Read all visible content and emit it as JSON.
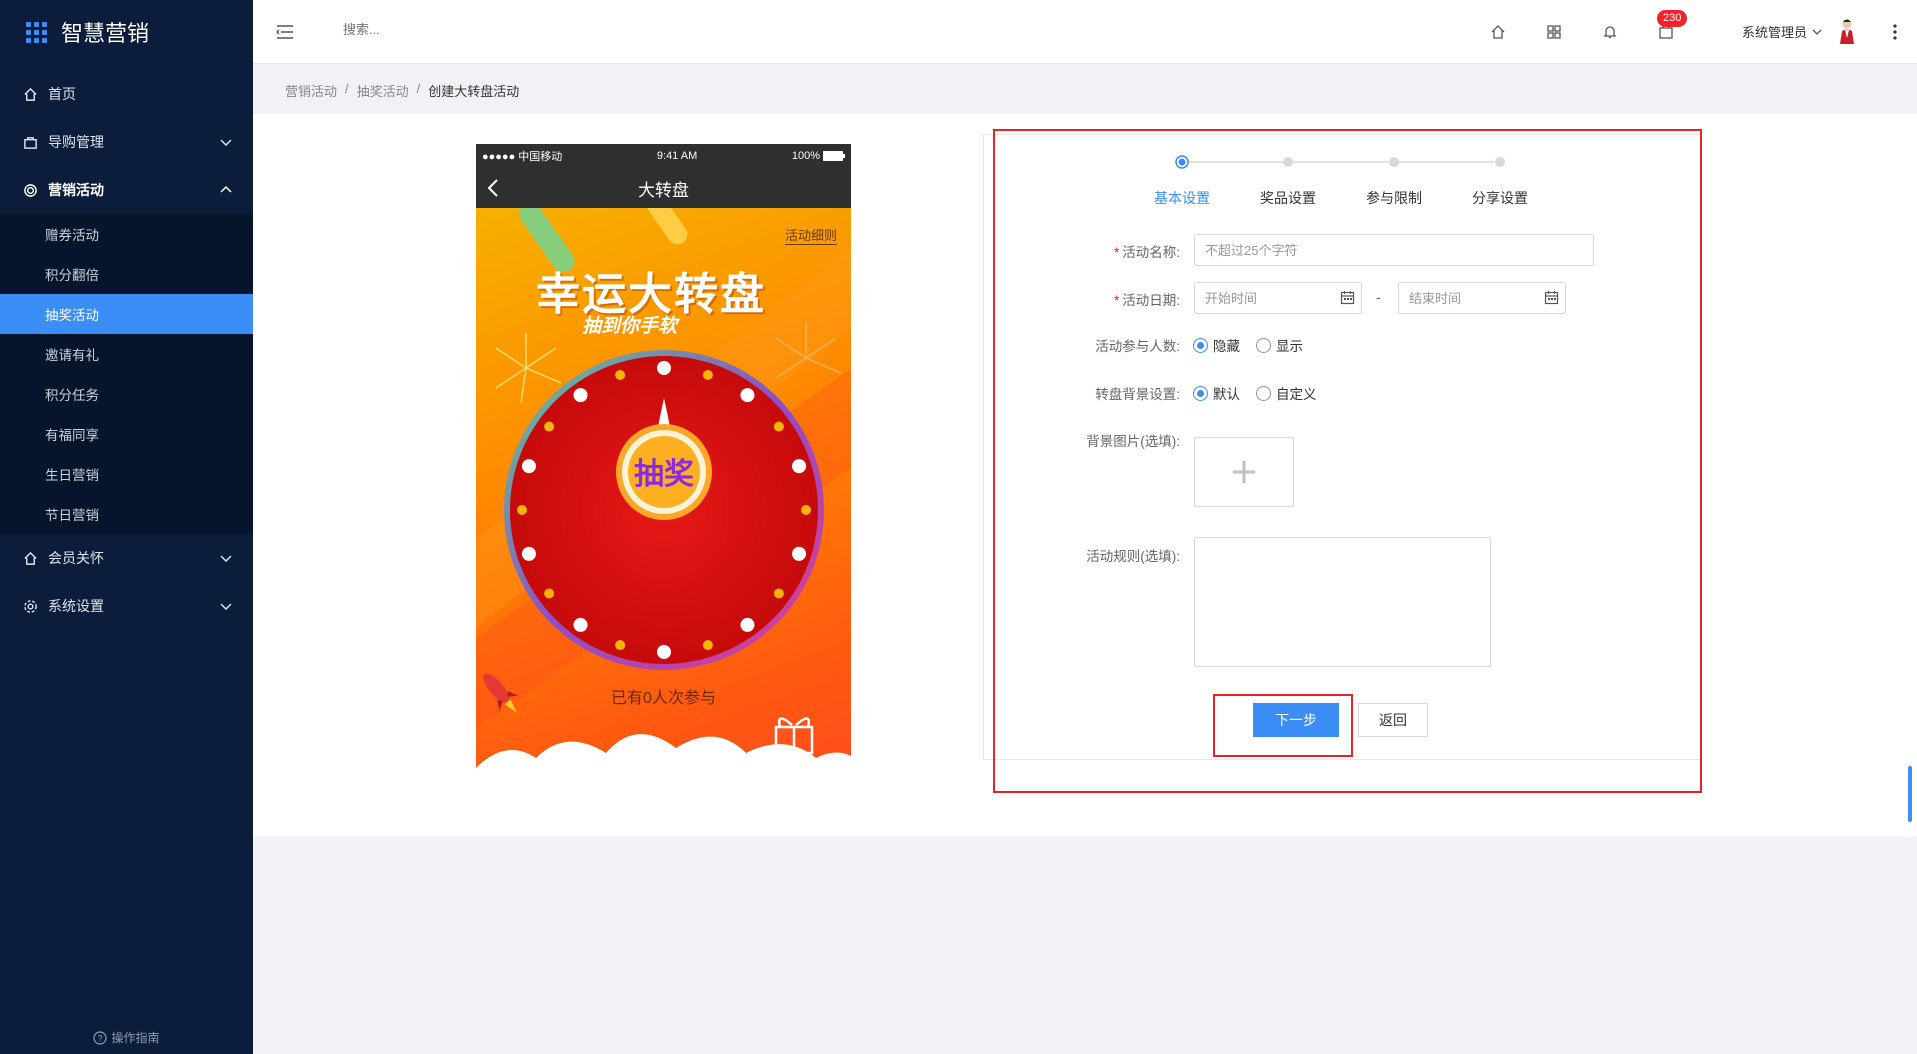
{
  "app": {
    "title": "智慧营销"
  },
  "sidebar": {
    "items": [
      {
        "label": "首页",
        "icon": "home-icon"
      },
      {
        "label": "导购管理",
        "icon": "bag-icon"
      },
      {
        "label": "营销活动",
        "icon": "target-icon"
      },
      {
        "label": "会员关怀",
        "icon": "home-icon"
      },
      {
        "label": "系统设置",
        "icon": "gear-icon"
      }
    ],
    "sub_items": [
      "赠券活动",
      "积分翻倍",
      "抽奖活动",
      "邀请有礼",
      "积分任务",
      "有福同享",
      "生日营销",
      "节日营销"
    ],
    "active_sub": "抽奖活动",
    "guide": "操作指南"
  },
  "topbar": {
    "search_placeholder": "搜索...",
    "badge_count": "230",
    "user_name": "系统管理员"
  },
  "breadcrumb": [
    "营销活动",
    "抽奖活动",
    "创建大转盘活动"
  ],
  "phone": {
    "carrier": "●●●●● 中国移动",
    "time": "9:41 AM",
    "battery": "100%",
    "title": "大转盘",
    "rules_link": "活动细则",
    "headline": "幸运大转盘",
    "tagline": "抽到你手软",
    "draw_button": "抽奖",
    "participants": "已有0人次参与"
  },
  "steps": [
    {
      "label": "基本设置",
      "active": true
    },
    {
      "label": "奖品设置",
      "active": false
    },
    {
      "label": "参与限制",
      "active": false
    },
    {
      "label": "分享设置",
      "active": false
    }
  ],
  "form": {
    "name_label": "活动名称:",
    "name_placeholder": "不超过25个字符",
    "date_label": "活动日期:",
    "start_placeholder": "开始时间",
    "end_placeholder": "结束时间",
    "date_sep": "-",
    "count_label": "活动参与人数:",
    "count_options": [
      "隐藏",
      "显示"
    ],
    "bg_label": "转盘背景设置:",
    "bg_options": [
      "默认",
      "自定义"
    ],
    "image_label": "背景图片(选填):",
    "rules_label": "活动规则(选填):",
    "next_button": "下一步",
    "back_button": "返回"
  },
  "colors": {
    "accent": "#3a8ef6",
    "sidebar": "#0b1d3a",
    "highlight": "#e5242a"
  }
}
